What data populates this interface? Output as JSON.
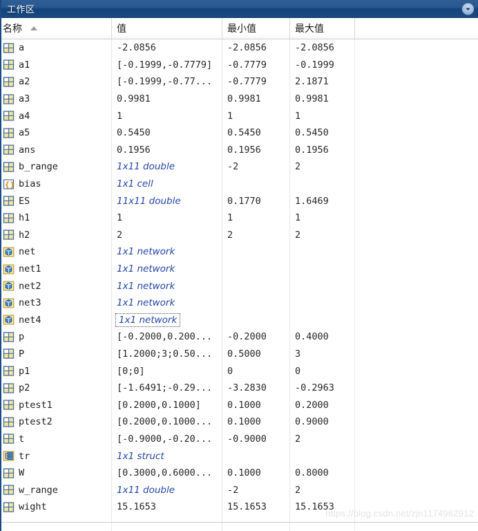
{
  "window": {
    "title": "工作区",
    "menu_icon": "chevron-down-circle-icon"
  },
  "table": {
    "columns": [
      {
        "key": "name",
        "label": "名称",
        "sorted": "asc"
      },
      {
        "key": "value",
        "label": "值"
      },
      {
        "key": "min",
        "label": "最小值"
      },
      {
        "key": "max",
        "label": "最大值"
      },
      {
        "key": "pad",
        "label": ""
      }
    ],
    "rows": [
      {
        "icon": "matrix-icon",
        "name": "a",
        "value": "-2.0856",
        "value_style": "plain",
        "min": "-2.0856",
        "max": "-2.0856"
      },
      {
        "icon": "matrix-icon",
        "name": "a1",
        "value": "[-0.1999,-0.7779]",
        "value_style": "plain",
        "min": "-0.7779",
        "max": "-0.1999"
      },
      {
        "icon": "matrix-icon",
        "name": "a2",
        "value": "[-0.1999,-0.77...",
        "value_style": "plain",
        "min": "-0.7779",
        "max": "2.1871"
      },
      {
        "icon": "matrix-icon",
        "name": "a3",
        "value": "0.9981",
        "value_style": "plain",
        "min": "0.9981",
        "max": "0.9981"
      },
      {
        "icon": "matrix-icon",
        "name": "a4",
        "value": "1",
        "value_style": "plain",
        "min": "1",
        "max": "1"
      },
      {
        "icon": "matrix-icon",
        "name": "a5",
        "value": "0.5450",
        "value_style": "plain",
        "min": "0.5450",
        "max": "0.5450"
      },
      {
        "icon": "matrix-icon",
        "name": "ans",
        "value": "0.1956",
        "value_style": "plain",
        "min": "0.1956",
        "max": "0.1956"
      },
      {
        "icon": "matrix-icon",
        "name": "b_range",
        "value": "1x11 double",
        "value_style": "summary",
        "min": "-2",
        "max": "2"
      },
      {
        "icon": "cell-icon",
        "name": "bias",
        "value": "1x1 cell",
        "value_style": "summary",
        "min": "",
        "max": ""
      },
      {
        "icon": "matrix-icon",
        "name": "ES",
        "value": "11x11 double",
        "value_style": "summary",
        "min": "0.1770",
        "max": "1.6469"
      },
      {
        "icon": "matrix-icon",
        "name": "h1",
        "value": "1",
        "value_style": "plain",
        "min": "1",
        "max": "1"
      },
      {
        "icon": "matrix-icon",
        "name": "h2",
        "value": "2",
        "value_style": "plain",
        "min": "2",
        "max": "2"
      },
      {
        "icon": "network-icon",
        "name": "net",
        "value": "1x1 network",
        "value_style": "summary",
        "min": "",
        "max": ""
      },
      {
        "icon": "network-icon",
        "name": "net1",
        "value": "1x1 network",
        "value_style": "summary",
        "min": "",
        "max": ""
      },
      {
        "icon": "network-icon",
        "name": "net2",
        "value": "1x1 network",
        "value_style": "summary",
        "min": "",
        "max": ""
      },
      {
        "icon": "network-icon",
        "name": "net3",
        "value": "1x1 network",
        "value_style": "summary",
        "min": "",
        "max": ""
      },
      {
        "icon": "network-icon",
        "name": "net4",
        "value": "1x1 network",
        "value_style": "summary",
        "focused": true,
        "min": "",
        "max": ""
      },
      {
        "icon": "matrix-icon",
        "name": "p",
        "value": "[-0.2000,0.200...",
        "value_style": "plain",
        "min": "-0.2000",
        "max": "0.4000"
      },
      {
        "icon": "matrix-icon",
        "name": "P",
        "value": "[1.2000;3;0.50...",
        "value_style": "plain",
        "min": "0.5000",
        "max": "3"
      },
      {
        "icon": "matrix-icon",
        "name": "p1",
        "value": "[0;0]",
        "value_style": "plain",
        "min": "0",
        "max": "0"
      },
      {
        "icon": "matrix-icon",
        "name": "p2",
        "value": "[-1.6491;-0.29...",
        "value_style": "plain",
        "min": "-3.2830",
        "max": "-0.2963"
      },
      {
        "icon": "matrix-icon",
        "name": "ptest1",
        "value": "[0.2000,0.1000]",
        "value_style": "plain",
        "min": "0.1000",
        "max": "0.2000"
      },
      {
        "icon": "matrix-icon",
        "name": "ptest2",
        "value": "[0.2000,0.1000...",
        "value_style": "plain",
        "min": "0.1000",
        "max": "0.9000"
      },
      {
        "icon": "matrix-icon",
        "name": "t",
        "value": "[-0.9000,-0.20...",
        "value_style": "plain",
        "min": "-0.9000",
        "max": "2"
      },
      {
        "icon": "struct-icon",
        "name": "tr",
        "value": "1x1 struct",
        "value_style": "summary",
        "min": "",
        "max": ""
      },
      {
        "icon": "matrix-icon",
        "name": "W",
        "value": "[0.3000,0.6000...",
        "value_style": "plain",
        "min": "0.1000",
        "max": "0.8000"
      },
      {
        "icon": "matrix-icon",
        "name": "w_range",
        "value": "1x11 double",
        "value_style": "summary",
        "min": "-2",
        "max": "2"
      },
      {
        "icon": "matrix-icon",
        "name": "wight",
        "value": "15.1653",
        "value_style": "plain",
        "min": "15.1653",
        "max": "15.1653"
      }
    ]
  },
  "watermark": {
    "text": "https://blog.csdn.net/zjn1174962912"
  },
  "colors": {
    "titlebar": "#1a4a86",
    "summary_text": "#2446a8",
    "grid_line": "#e8e8e8",
    "icon_matrix_fill": "#f5e9a8",
    "icon_network_fill": "#3f7fc1"
  }
}
